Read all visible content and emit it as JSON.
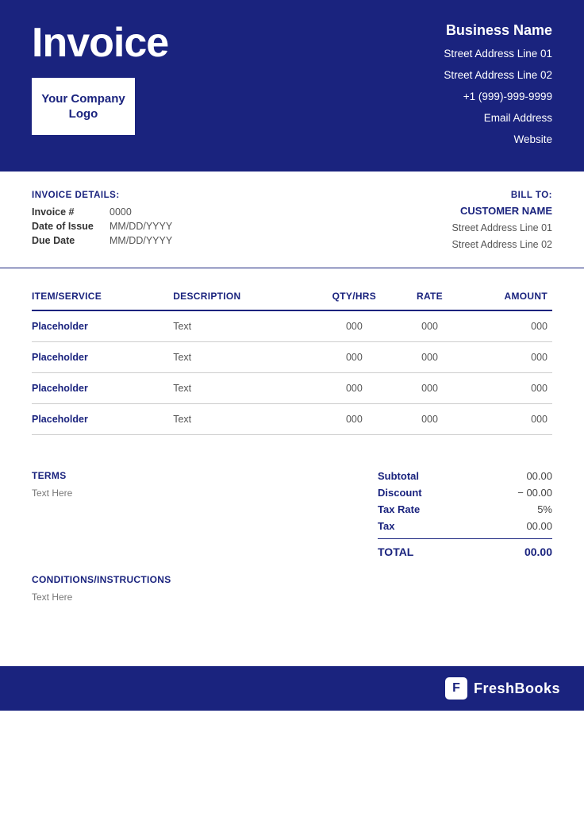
{
  "header": {
    "title": "Invoice",
    "logo_text": "Your Company Logo",
    "business_name": "Business Name",
    "address_line1": "Street Address Line 01",
    "address_line2": "Street Address Line 02",
    "phone": "+1 (999)-999-9999",
    "email": "Email Address",
    "website": "Website"
  },
  "invoice_details": {
    "section_label": "INVOICE DETAILS:",
    "invoice_number_label": "Invoice #",
    "invoice_number_value": "0000",
    "date_of_issue_label": "Date of Issue",
    "date_of_issue_value": "MM/DD/YYYY",
    "due_date_label": "Due Date",
    "due_date_value": "MM/DD/YYYY"
  },
  "bill_to": {
    "label": "BILL TO:",
    "customer_name": "CUSTOMER NAME",
    "address_line1": "Street Address Line 01",
    "address_line2": "Street Address Line 02"
  },
  "table": {
    "columns": [
      "ITEM/SERVICE",
      "DESCRIPTION",
      "QTY/HRS",
      "RATE",
      "AMOUNT"
    ],
    "rows": [
      {
        "item": "Placeholder",
        "description": "Text",
        "qty": "000",
        "rate": "000",
        "amount": "000"
      },
      {
        "item": "Placeholder",
        "description": "Text",
        "qty": "000",
        "rate": "000",
        "amount": "000"
      },
      {
        "item": "Placeholder",
        "description": "Text",
        "qty": "000",
        "rate": "000",
        "amount": "000"
      },
      {
        "item": "Placeholder",
        "description": "Text",
        "qty": "000",
        "rate": "000",
        "amount": "000"
      }
    ]
  },
  "terms": {
    "title": "TERMS",
    "text": "Text Here"
  },
  "totals": {
    "subtotal_label": "Subtotal",
    "subtotal_value": "00.00",
    "discount_label": "Discount",
    "discount_value": "− 00.00",
    "tax_rate_label": "Tax Rate",
    "tax_rate_value": "5%",
    "tax_label": "Tax",
    "tax_value": "00.00",
    "total_label": "TOTAL",
    "total_value": "00.00"
  },
  "conditions": {
    "title": "CONDITIONS/INSTRUCTIONS",
    "text": "Text Here"
  },
  "footer": {
    "brand_icon": "F",
    "brand_name": "FreshBooks"
  }
}
